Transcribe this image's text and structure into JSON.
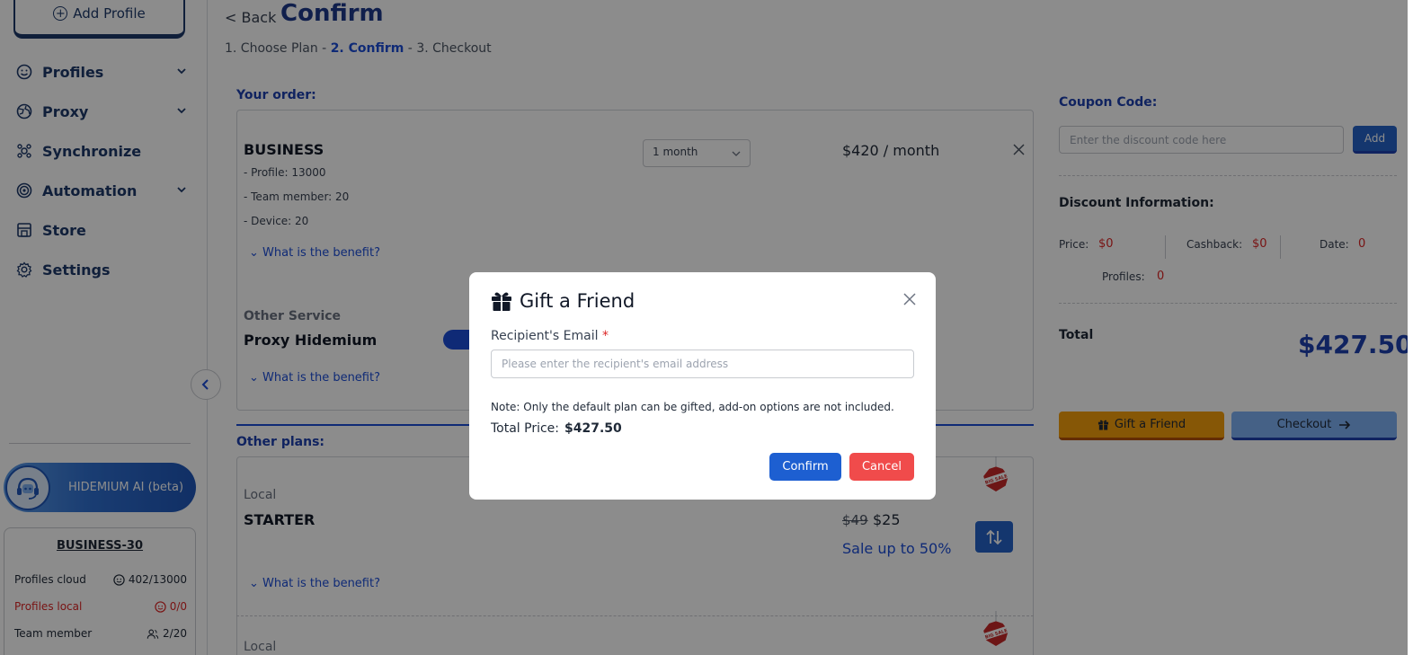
{
  "sidebar": {
    "add_profile": "Add Profile",
    "items": [
      {
        "label": "Profiles",
        "icon": "smile-icon",
        "has_chevron": true
      },
      {
        "label": "Proxy",
        "icon": "globe-icon",
        "has_chevron": true
      },
      {
        "label": "Synchronize",
        "icon": "sync-icon",
        "has_chevron": false
      },
      {
        "label": "Automation",
        "icon": "target-icon",
        "has_chevron": true
      },
      {
        "label": "Store",
        "icon": "store-icon",
        "has_chevron": false
      },
      {
        "label": "Settings",
        "icon": "gear-icon",
        "has_chevron": false
      }
    ],
    "ai_button": "HIDEMIUM AI (beta)",
    "plan": {
      "title": "BUSINESS-30",
      "rows": [
        {
          "label": "Profiles cloud",
          "value": "402/13000"
        },
        {
          "label": "Profiles local",
          "value": "0/0"
        },
        {
          "label": "Team member",
          "value": "2/20"
        }
      ]
    }
  },
  "header": {
    "back": "< Back",
    "title": "Confirm",
    "steps": {
      "step1": "1. Choose Plan",
      "sep1": " - ",
      "step2": "2. Confirm",
      "sep2": " - ",
      "step3": "3. Checkout"
    }
  },
  "order": {
    "label": "Your order:",
    "plan_name": "BUSINESS",
    "features": [
      "- Profile: 13000",
      "- Team member: 20",
      "- Device: 20"
    ],
    "benefit_link": "What is the benefit?",
    "duration": "1 month",
    "price": "$420 / month",
    "other_service_label": "Other Service",
    "other_service_name": "Proxy Hidemium",
    "other_benefit_link": "What is the benefit?"
  },
  "other_plans": {
    "label": "Other plans:",
    "items": [
      {
        "category": "Local",
        "name": "STARTER",
        "old_price": "$49",
        "new_price": "$25",
        "sale": "Sale up to 50%",
        "benefit_link": "What is the benefit?",
        "tag": "BIG SALE"
      },
      {
        "category": "Local",
        "tag": "BIG SALE"
      }
    ]
  },
  "coupon": {
    "label": "Coupon Code:",
    "placeholder": "Enter the discount code here",
    "add_label": "Add"
  },
  "discount": {
    "title": "Discount Information:",
    "price_label": "Price:",
    "price_value": "$0",
    "cashback_label": "Cashback:",
    "cashback_value": "$0",
    "date_label": "Date:",
    "date_value": "0",
    "profiles_label": "Profiles:",
    "profiles_value": "0"
  },
  "total": {
    "label": "Total",
    "value": "$427.50"
  },
  "actions": {
    "gift": "Gift a Friend",
    "checkout": "Checkout"
  },
  "modal": {
    "title": "Gift a Friend",
    "field_label": "Recipient's Email",
    "required_mark": "*",
    "placeholder": "Please enter the recipient's email address",
    "note": "Note: Only the default plan can be gifted, add-on options are not included.",
    "total_label": "Total Price:",
    "total_value": "$427.50",
    "confirm": "Confirm",
    "cancel": "Cancel"
  },
  "colors": {
    "primary": "#1d5fd1",
    "danger": "#f04b4b",
    "gift": "#f59e0b",
    "heading": "#1e3a8a",
    "discount_value": "#dc2626"
  }
}
